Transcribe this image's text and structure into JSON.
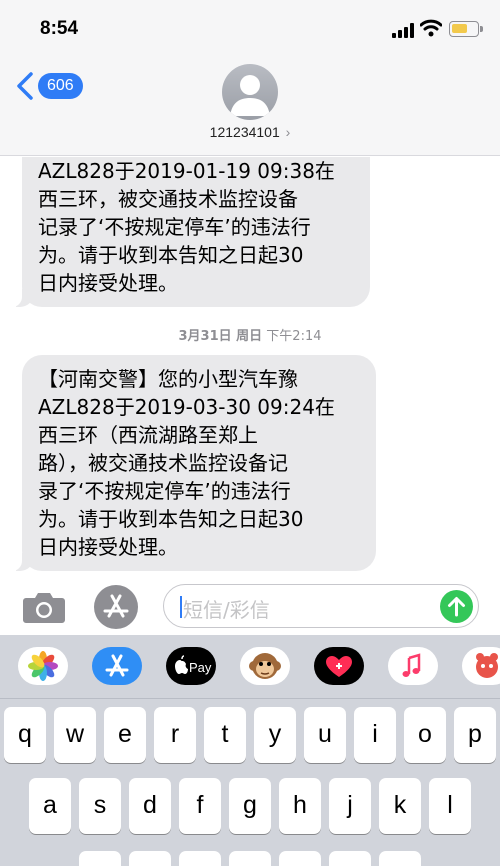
{
  "status_bar": {
    "time": "8:54"
  },
  "header": {
    "back_count": "606",
    "contact": "121234101",
    "contact_chevron": "›"
  },
  "messages": [
    {
      "lines": [
        "AZL828于2019-01-19 09:38在",
        "西三环，被交通技术监控设备",
        "记录了‘不按规定停车’的违法行",
        "为。请于收到本告知之日起30",
        "日内接受处理。"
      ]
    },
    {
      "lines": [
        "【河南交警】您的小型汽车豫",
        "AZL828于2019-03-30 09:24在",
        "西三环（西流湖路至郑上",
        "路），被交通技术监控设备记",
        "录了‘不按规定停车’的违法行",
        "为。请于收到本告知之日起30",
        "日内接受处理。"
      ]
    }
  ],
  "timestamp": {
    "date": "3月31日 周日",
    "time": "下午2:14"
  },
  "input": {
    "placeholder": "短信/彩信"
  },
  "app_strip": [
    {
      "name": "photos",
      "icon": "photos-icon"
    },
    {
      "name": "app-store",
      "icon": "app-store-icon"
    },
    {
      "name": "apple-pay",
      "icon": "apple-pay-icon",
      "label": "Pay"
    },
    {
      "name": "animoji",
      "icon": "monkey-icon"
    },
    {
      "name": "digital-touch",
      "icon": "heart-icon"
    },
    {
      "name": "music",
      "icon": "music-icon"
    },
    {
      "name": "sticker",
      "icon": "sticker-icon"
    }
  ],
  "keyboard": {
    "row1": [
      "q",
      "w",
      "e",
      "r",
      "t",
      "y",
      "u",
      "i",
      "o",
      "p"
    ],
    "row2": [
      "a",
      "s",
      "d",
      "f",
      "g",
      "h",
      "j",
      "k",
      "l"
    ]
  },
  "colors": {
    "accent": "#2f7cf6",
    "send": "#34c759",
    "bubble": "#e9e9eb",
    "keyboard_bg": "#d1d4db"
  }
}
